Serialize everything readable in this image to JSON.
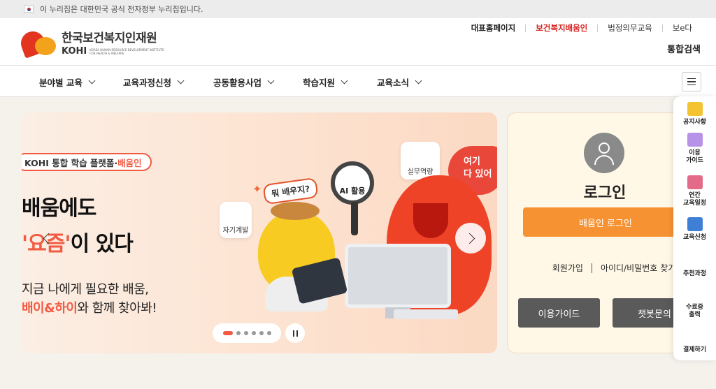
{
  "gov_banner": {
    "text": "이 누리집은 대한민국 공식 전자정부 누리집입니다."
  },
  "logo": {
    "name_ko": "한국보건복지인재원",
    "name_en": "KOHI",
    "subtitle": "KOREA HUMAN RESOURCE DEVELOPMENT INSTITUTE FOR HEALTH & WELFARE"
  },
  "top_links": [
    {
      "label": "대표홈페이지"
    },
    {
      "label": "보건복지배움인"
    },
    {
      "label": "법정의무교육"
    },
    {
      "label": "보e다"
    }
  ],
  "search_label": "통합검색",
  "nav": {
    "items": [
      {
        "label": "분야별 교육"
      },
      {
        "label": "교육과정신청"
      },
      {
        "label": "공동활용사업"
      },
      {
        "label": "학습지원"
      },
      {
        "label": "교육소식"
      }
    ]
  },
  "banner": {
    "tag_prefix": "KOHI 통합 학습 플랫폼·",
    "tag_highlight": "배움인",
    "headline1": "배움에도",
    "headline2_orange": "'요즘'",
    "headline2_rest": "이 있다",
    "desc1": "지금 나에게 필요한 배움,",
    "desc2_hl1": "배이",
    "desc2_amp": "&",
    "desc2_hl2": "하이",
    "desc2_rest": "와 함께 찾아봐!",
    "speech": "뭐 배우지?",
    "magnifier_label": "AI 활용",
    "bubble_self": "자기계발",
    "bubble_job": "실무역량",
    "speech2_line1": "여기",
    "speech2_line2": "다 있어",
    "slide_count": 6,
    "active_slide": 1
  },
  "login": {
    "title": "로그인",
    "button": "배움인 로그인",
    "signup": "회원가입",
    "find": "아이디/비밀번호 찾기",
    "guide": "이용가이드",
    "chatbot": "챗봇문의"
  },
  "quick_menu": [
    {
      "label": "공지사항",
      "icon": "notice-icon",
      "color": "#f4c430"
    },
    {
      "label": "이용\n가이드",
      "icon": "guide-icon",
      "color": "#b892e6"
    },
    {
      "label": "연간\n교육일정",
      "icon": "calendar-icon",
      "color": "#e46a8a"
    },
    {
      "label": "교육신청",
      "icon": "apply-icon",
      "color": "#3f7fd6"
    },
    {
      "label": "추천과정",
      "icon": "",
      "color": ""
    },
    {
      "label": "수료증\n출력",
      "icon": "",
      "color": ""
    },
    {
      "label": "결제하기",
      "icon": "",
      "color": ""
    }
  ],
  "colors": {
    "accent": "#f25b43",
    "brand_red": "#d5221f",
    "login_button": "#f79232"
  }
}
